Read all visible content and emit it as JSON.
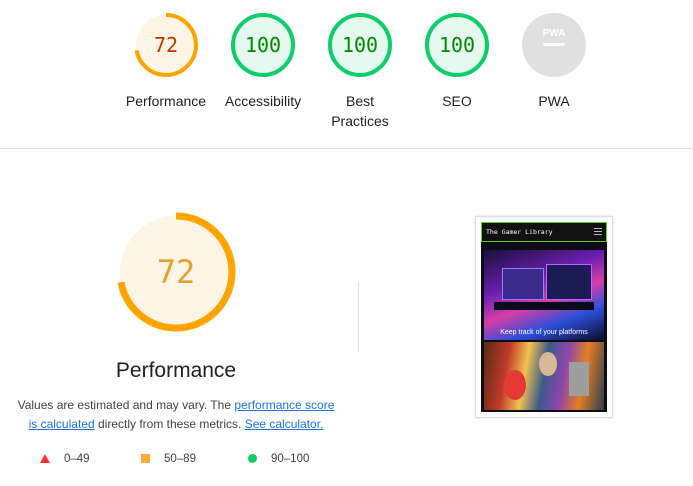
{
  "colors": {
    "pass": "#0cce6b",
    "pass_text": "#008800",
    "pass_fill": "#e6f9ee",
    "average": "#ffa400",
    "average_text": "#c33300",
    "average_fill": "#fff5e6",
    "fail": "#ff3333",
    "na_fill": "#e0e0e0"
  },
  "categories": [
    {
      "label": "Performance",
      "score": "72",
      "value": 72,
      "status": "average"
    },
    {
      "label": "Accessibility",
      "score": "100",
      "value": 100,
      "status": "pass"
    },
    {
      "label": "Best Practices",
      "score": "100",
      "value": 100,
      "status": "pass"
    },
    {
      "label": "SEO",
      "score": "100",
      "value": 100,
      "status": "pass"
    },
    {
      "label": "PWA",
      "score": "",
      "value": null,
      "status": "na",
      "badge": "PWA"
    }
  ],
  "detail": {
    "score": "72",
    "value": 72,
    "title": "Performance",
    "desc_prefix": "Values are estimated and may vary. The ",
    "desc_link1": "performance score is calculated",
    "desc_middle": " directly from these metrics. ",
    "desc_link2": "See calculator."
  },
  "legend": [
    {
      "shape": "triangle-icon",
      "range": "0–49"
    },
    {
      "shape": "square-icon",
      "range": "50–89"
    },
    {
      "shape": "circle-icon",
      "range": "90–100"
    }
  ],
  "screenshot": {
    "site_title": "The Gamer Library",
    "hero_caption": "Keep track of your platforms"
  }
}
